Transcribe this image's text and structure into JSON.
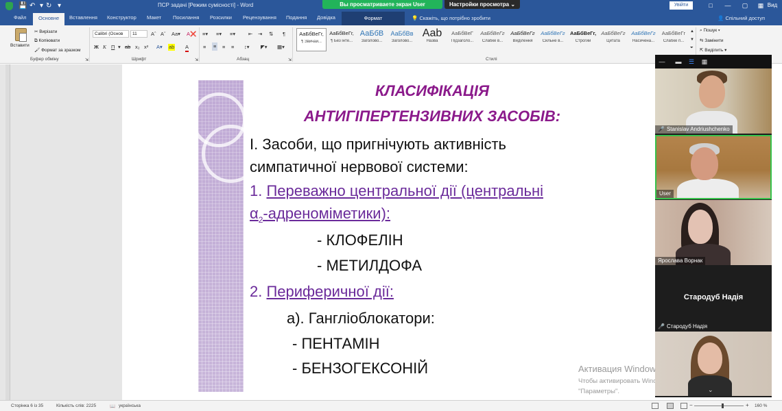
{
  "titlebar": {
    "doc_title": "ПСР задачі [Режим сумісності]  -  Word",
    "share_banner": "Вы просматриваете экран User",
    "view_settings": "Настройки просмотра",
    "sign_in": "Увійти",
    "view_cut": "Вид"
  },
  "tabs": {
    "file": "Файл",
    "home": "Основне",
    "insert": "Вставлення",
    "design": "Конструктор",
    "layout": "Макет",
    "references": "Посилання",
    "mailings": "Розсилки",
    "review": "Рецензування",
    "view": "Подання",
    "help": "Довідка",
    "format": "Формат",
    "tell_me": "Скажіть, що потрібно зробити",
    "share": "Спільний доступ"
  },
  "ribbon": {
    "clipboard": {
      "paste": "Вставити",
      "cut": "Вирізати",
      "copy": "Копіювати",
      "format_painter": "Формат за зразком",
      "label": "Буфер обміну"
    },
    "font": {
      "name": "Calibri (Основ",
      "size": "11",
      "label": "Шрифт"
    },
    "paragraph": {
      "label": "Абзац"
    },
    "styles": {
      "label": "Стилі",
      "items": [
        {
          "sample": "АаБбВеГг,",
          "name": "¶ Звичай..."
        },
        {
          "sample": "АаБбВеГг,",
          "name": "¶ Без інте..."
        },
        {
          "sample": "АаБбВ",
          "name": "Заголово..."
        },
        {
          "sample": "АаБбВв",
          "name": "Заголово..."
        },
        {
          "sample": "Aab",
          "name": "Назва"
        },
        {
          "sample": "АаБбВеГ",
          "name": "Підзаголо..."
        },
        {
          "sample": "АаБбВеГг",
          "name": "Слабке в..."
        },
        {
          "sample": "АаБбВеГг",
          "name": "Виділення"
        },
        {
          "sample": "АаБбВеГг",
          "name": "Сильне в..."
        },
        {
          "sample": "АаБбВеГг,",
          "name": "Строгий"
        },
        {
          "sample": "АаБбВеГг",
          "name": "Цитата"
        },
        {
          "sample": "АаБбВеГг",
          "name": "Насичена..."
        },
        {
          "sample": "АаБбВеГг",
          "name": "Слабке п..."
        }
      ]
    },
    "editing": {
      "find": "Пошук",
      "replace": "Замінити",
      "select": "Виділить"
    }
  },
  "slide": {
    "title_line1": "КЛАСИФІКАЦІЯ",
    "title_line2": "АНТИГІПЕРТЕНЗИВНИХ ЗАСОБІВ:",
    "heading_line1": "І. Засоби, що пригнічують активність",
    "heading_line2": "симпатичної нервової системи:",
    "item1_num": "1.",
    "item1_line1": "Переважно центральної дії (центральні",
    "item1_line2_pre": "α",
    "item1_line2_sub": "2",
    "item1_line2_post": "-адреноміметики):",
    "drug1": "- КЛОФЕЛІН",
    "drug2": "- МЕТИЛДОФА",
    "item2_num": "2.",
    "item2_text": "Периферичної дії:",
    "sub_a": "а). Гангліоблокатори:",
    "drug3": "- ПЕНТАМІН",
    "drug4": "- БЕНЗОГЕКСОНІЙ"
  },
  "watermark": {
    "line1": "Активация Windows",
    "line2": "Чтобы активировать Windows, перейдите в раздел",
    "line3": "\"Параметры\"."
  },
  "video": {
    "participants": [
      {
        "name": "Stanislav Andriushchenko",
        "muted": true
      },
      {
        "name": "User",
        "muted": false
      },
      {
        "name": "Ярослава Ворнак",
        "muted": false
      },
      {
        "name": "Стародуб Надія",
        "muted": true
      },
      {
        "name": "",
        "muted": false
      }
    ],
    "no_video_name": "Стародуб Надія"
  },
  "statusbar": {
    "page": "Сторінка 6 із 35",
    "words": "Кількість слів: 2225",
    "language": "українська",
    "zoom": "160 %"
  }
}
